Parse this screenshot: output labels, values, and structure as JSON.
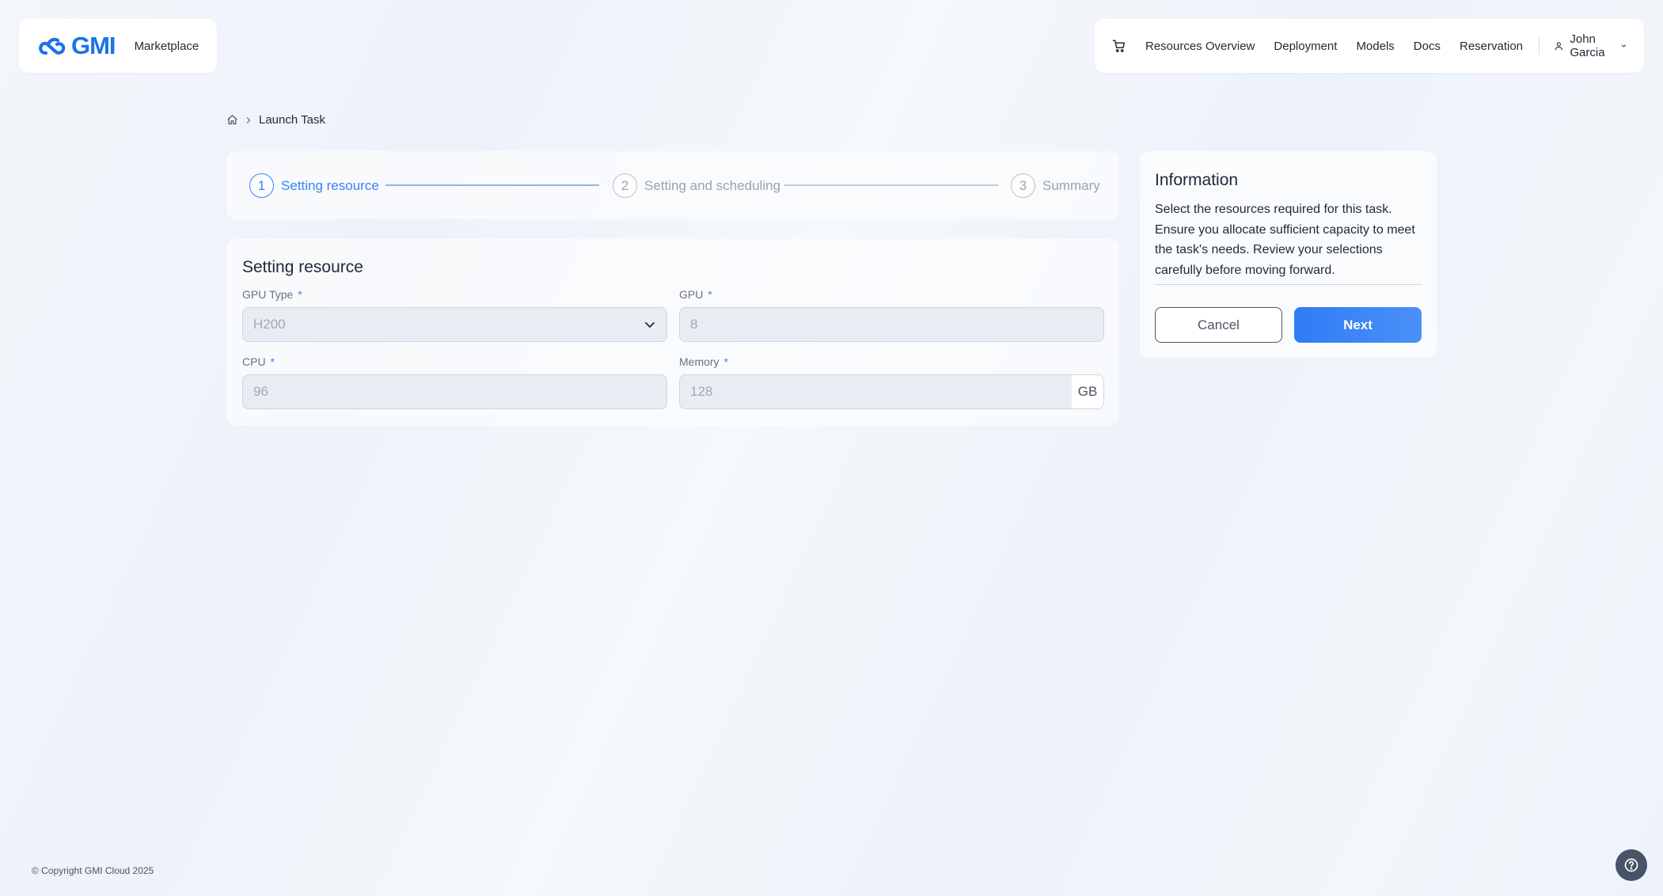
{
  "brand": {
    "logo_text": "GMI",
    "section": "Marketplace"
  },
  "nav": {
    "cart_icon": "cart-icon",
    "items": [
      "Resources Overview",
      "Deployment",
      "Models",
      "Docs",
      "Reservation"
    ],
    "user_name": "John Garcia"
  },
  "breadcrumb": {
    "home_icon": "home-icon",
    "current": "Launch Task"
  },
  "stepper": {
    "steps": [
      {
        "number": "1",
        "label": "Setting resource"
      },
      {
        "number": "2",
        "label": "Setting and scheduling"
      },
      {
        "number": "3",
        "label": "Summary"
      }
    ],
    "active_step": 1
  },
  "form": {
    "title": "Setting resource",
    "gpu_type": {
      "label": "GPU Type",
      "required": "*",
      "value": "H200"
    },
    "gpu": {
      "label": "GPU",
      "required": "*",
      "value": "8"
    },
    "cpu": {
      "label": "CPU",
      "required": "*",
      "value": "96"
    },
    "memory": {
      "label": "Memory",
      "required": "*",
      "value": "128",
      "unit": "GB"
    }
  },
  "info": {
    "title": "Information",
    "text": "Select the resources required for this task. Ensure you allocate sufficient capacity to meet the task's needs. Review your selections carefully before moving forward.",
    "cancel_label": "Cancel",
    "next_label": "Next"
  },
  "footer": {
    "copyright": "© Copyright GMI Cloud 2025",
    "help_icon": "help-icon"
  },
  "colors": {
    "accent": "#3b82f6",
    "brand": "#1a73e8"
  }
}
